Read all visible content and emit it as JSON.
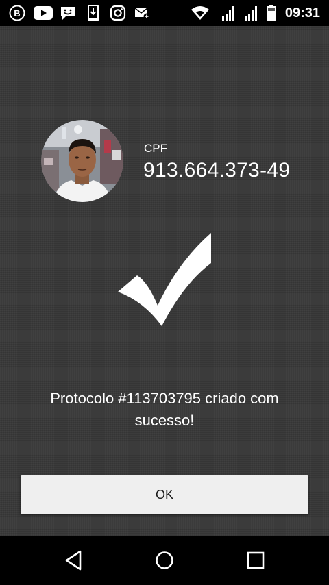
{
  "status_bar": {
    "time": "09:31",
    "left_icons": [
      "b-circle-icon",
      "youtube-icon",
      "chat-icon",
      "download-icon",
      "instagram-icon",
      "mail-icon"
    ],
    "right_icons": [
      "wifi-icon",
      "signal-icon",
      "signal-icon",
      "battery-icon"
    ]
  },
  "profile": {
    "cpf_label": "CPF",
    "cpf_value": "913.664.373-49"
  },
  "message": {
    "line1": "Protocolo #113703795 criado com",
    "line2": "sucesso!"
  },
  "ok_button": {
    "label": "OK"
  },
  "nav_bar": {
    "icons": [
      "back-icon",
      "home-icon",
      "recents-icon"
    ]
  }
}
